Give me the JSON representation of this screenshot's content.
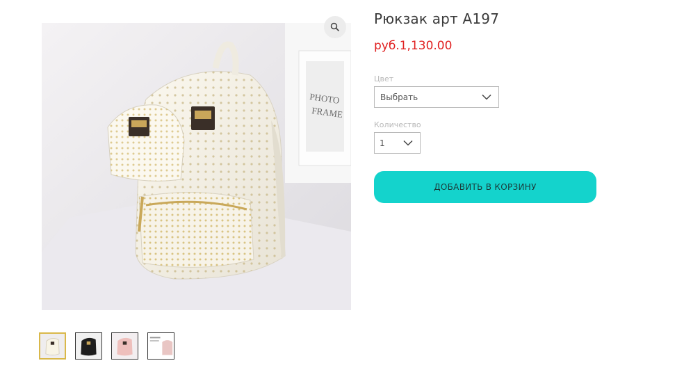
{
  "product": {
    "title": "Рюкзак арт А197",
    "price": "руб.1,130.00"
  },
  "options": {
    "color_label": "Цвет",
    "color_value": "Выбрать",
    "quantity_label": "Количество",
    "quantity_value": "1"
  },
  "actions": {
    "add_to_cart": "ДОБАВИТЬ В КОРЗИНУ"
  },
  "gallery": {
    "zoom_icon": "magnifier-icon",
    "thumbnails": [
      {
        "name": "white",
        "active": true
      },
      {
        "name": "black",
        "active": false
      },
      {
        "name": "pink",
        "active": false
      },
      {
        "name": "other",
        "active": false
      }
    ]
  },
  "colors": {
    "price": "#e02020",
    "button": "#14d3cc",
    "active_thumb_border": "#d9b84a"
  }
}
